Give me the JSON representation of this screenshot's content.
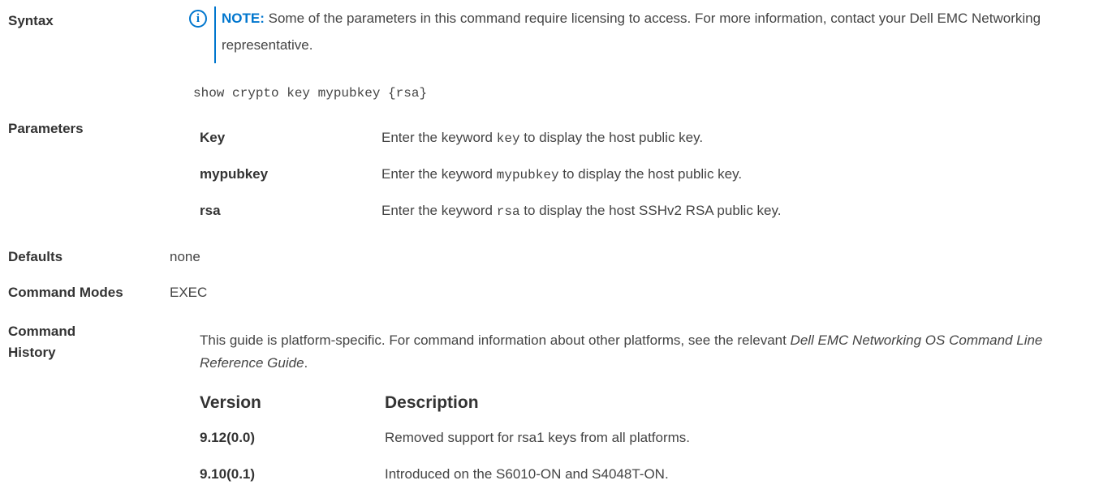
{
  "labels": {
    "syntax": "Syntax",
    "parameters": "Parameters",
    "defaults": "Defaults",
    "command_modes": "Command Modes",
    "command_history_1": "Command",
    "command_history_2": "History"
  },
  "note": {
    "icon": "info-icon",
    "heading": "NOTE:",
    "text": " Some of the parameters in this command require licensing to access. For more information, contact your Dell EMC Networking representative."
  },
  "syntax": "show crypto key mypubkey {rsa}",
  "parameters": [
    {
      "name": "Key",
      "pre": "Enter the keyword ",
      "code": "key",
      "post": " to display the host public key."
    },
    {
      "name": "mypubkey",
      "pre": "Enter the keyword ",
      "code": "mypubkey",
      "post": " to display the host public key."
    },
    {
      "name": "rsa",
      "pre": "Enter the keyword ",
      "code": "rsa",
      "post": " to display the host SSHv2 RSA public key."
    }
  ],
  "defaults": "none",
  "command_modes": "EXEC",
  "history": {
    "pre": "This guide is platform-specific. For command information about other platforms, see the relevant ",
    "italic": "Dell EMC Networking OS Command Line Reference Guide",
    "post": "."
  },
  "versions": {
    "header_version": "Version",
    "header_description": "Description",
    "rows": [
      {
        "version": "9.12(0.0)",
        "description": "Removed support for rsa1 keys from all platforms."
      },
      {
        "version": "9.10(0.1)",
        "description": "Introduced on the S6010-ON and S4048T-ON."
      }
    ]
  }
}
